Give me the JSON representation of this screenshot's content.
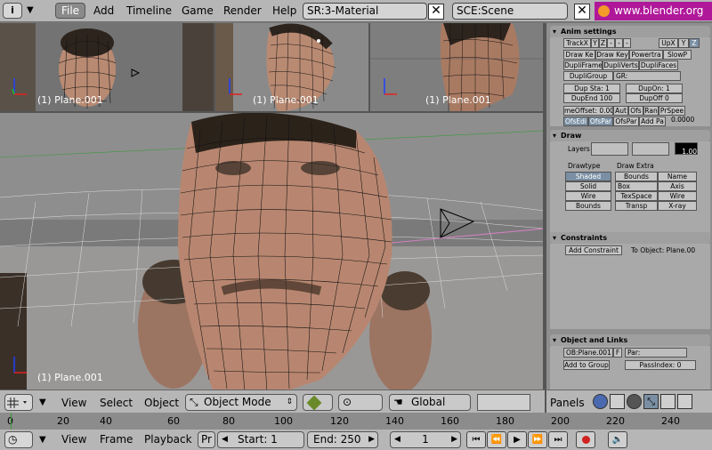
{
  "menubar": {
    "info_icon": "i",
    "items": [
      "File",
      "Add",
      "Timeline",
      "Game",
      "Render",
      "Help"
    ],
    "screen_field": "SR:3-Material",
    "scene_field": "SCE:Scene",
    "website": "www.blender.org 2"
  },
  "viewports": {
    "top_left_label": "(1) Plane.001",
    "top_mid_label": "(1) Plane.001",
    "top_right_label": "(1) Plane.001",
    "main_label": "(1) Plane.001"
  },
  "panel": {
    "anim": {
      "title": "Anim settings",
      "track_x": "TrackX",
      "track_y": "Y",
      "track_z": "Z",
      "track_mz": "-",
      "up_x": "UpX",
      "up_y": "Y",
      "up_z": "Z",
      "draw_ke": "Draw Ke",
      "draw_key": "Draw Key",
      "powertra": "Powertra",
      "slowp": "SlowP",
      "dupli_frames": "DupliFrames",
      "dupli_verts": "DupliVerts",
      "dupli_faces": "DupliFaces",
      "dupli_group": "DupliGroup",
      "gr": "GR:",
      "dup_sta": "Dup Sta: 1",
      "dup_on": "DupOn: 1",
      "dup_end": "DupEnd 100",
      "dup_off": "DupOff 0",
      "time_offset": "meOffset: 0.00",
      "aut": "Aut",
      "ofs": "Ofs",
      "ran": "Ran",
      "prspee": "PrSpee",
      "ofs_edi": "OfsEdi",
      "ofs_par": "OfsPar",
      "ofs_par2": "OfsPar",
      "add_pa": "Add Pa",
      "value": "0.0000"
    },
    "draw": {
      "title": "Draw",
      "layers_label": "Layers",
      "pass_value": "1.00",
      "drawtype_label": "Drawtype",
      "draw_extra_label": "Draw Extra",
      "shaded": "Shaded",
      "solid": "Solid",
      "wire": "Wire",
      "bounds": "Bounds",
      "extra_bounds": "Bounds",
      "extra_box": "Box",
      "extra_texspace": "TexSpace",
      "extra_transp": "Transp",
      "extra_name": "Name",
      "extra_axis": "Axis",
      "extra_wire": "Wire",
      "extra_xray": "X-ray"
    },
    "constraints": {
      "title": "Constraints",
      "add_constraint": "Add Constraint",
      "to_object": "To Object: Plane.00"
    },
    "links": {
      "title": "Object and Links",
      "ob_field": "OB:Plane.001",
      "f": "F",
      "par": "Par:",
      "add_to_group": "Add to Group",
      "pass_index": "PassIndex: 0"
    }
  },
  "view_header": {
    "view": "View",
    "select": "Select",
    "object": "Object",
    "mode": "Object Mode",
    "orientation": "Global"
  },
  "panels_header": {
    "label": "Panels"
  },
  "timeline": {
    "ticks": [
      "0",
      "20",
      "40",
      "60",
      "80",
      "100",
      "120",
      "140",
      "160",
      "180",
      "200",
      "220",
      "240"
    ],
    "view": "View",
    "frame": "Frame",
    "playback": "Playback",
    "pr": "Pr",
    "start": "Start: 1",
    "end": "End: 250",
    "current": "1"
  },
  "colors": {
    "header_gray": "#b6b6b6",
    "panel_gray": "#8f8f8f",
    "skin": "#c8927a",
    "wire": "#111111",
    "record_red": "#d02020"
  }
}
